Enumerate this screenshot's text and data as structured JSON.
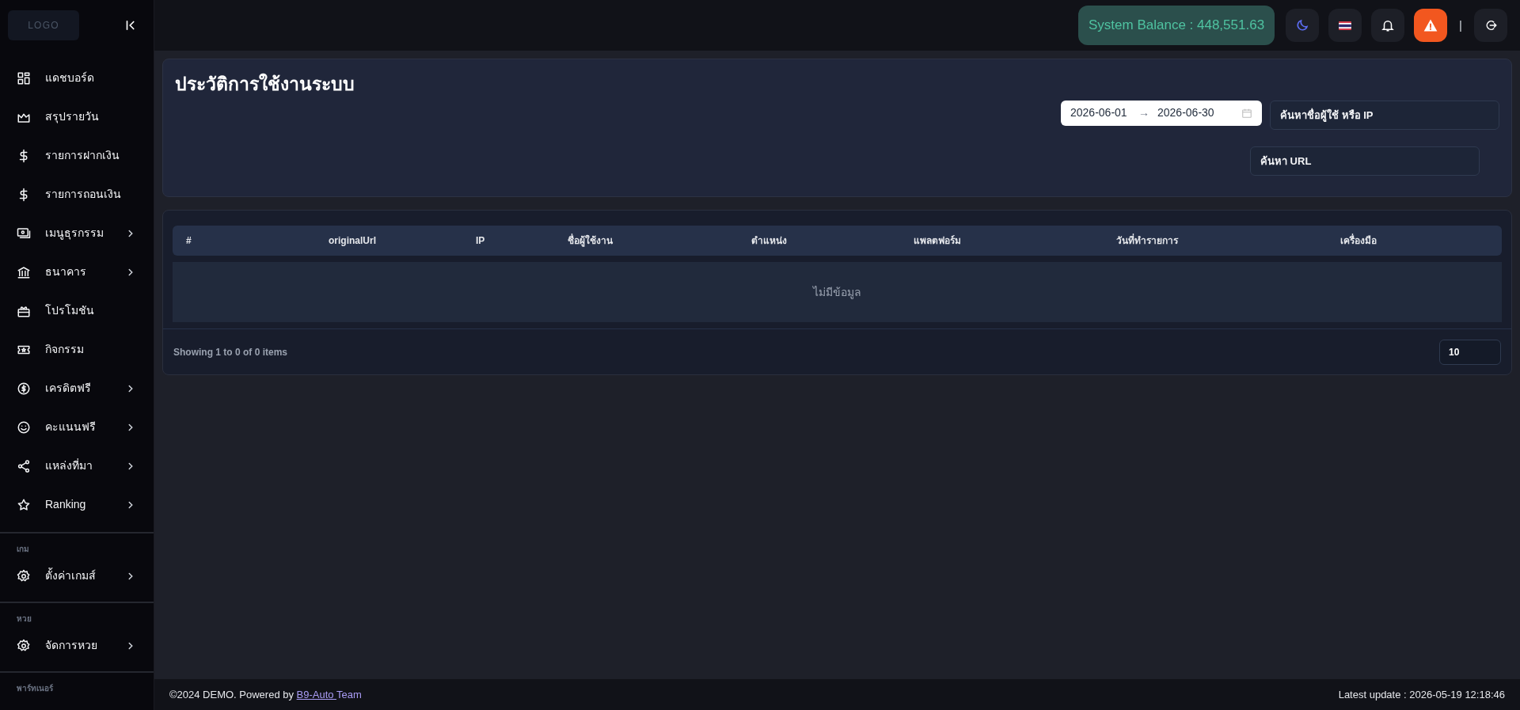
{
  "sidebar": {
    "logo": "LOGO",
    "items": [
      {
        "label": "แดชบอร์ด",
        "has_submenu": false
      },
      {
        "label": "สรุปรายวัน",
        "has_submenu": false
      },
      {
        "label": "รายการฝากเงิน",
        "has_submenu": false
      },
      {
        "label": "รายการถอนเงิน",
        "has_submenu": false
      },
      {
        "label": "เมนูธุรกรรม",
        "has_submenu": true
      },
      {
        "label": "ธนาคาร",
        "has_submenu": true
      },
      {
        "label": "โปรโมชัน",
        "has_submenu": false
      },
      {
        "label": "กิจกรรม",
        "has_submenu": false
      },
      {
        "label": "เครดิตฟรี",
        "has_submenu": true
      },
      {
        "label": "คะแนนฟรี",
        "has_submenu": true
      },
      {
        "label": "แหล่งที่มา",
        "has_submenu": true
      },
      {
        "label": "Ranking",
        "has_submenu": true
      }
    ],
    "sections": [
      {
        "label": "เกม",
        "items": [
          {
            "label": "ตั้งค่าเกมส์",
            "has_submenu": true
          }
        ]
      },
      {
        "label": "หวย",
        "items": [
          {
            "label": "จัดการหวย",
            "has_submenu": true
          }
        ]
      },
      {
        "label": "พาร์ทเนอร์"
      }
    ]
  },
  "topbar": {
    "balance": "System Balance : 448,551.63",
    "separator": "|"
  },
  "page": {
    "title": "ประวัติการใช้งานระบบ",
    "date_from": "2026-06-01",
    "date_to": "2026-06-30",
    "date_arrow": "→",
    "search_user": {
      "placeholder": "ค้นหาชื่อผู้ใช้ หรือ IP"
    },
    "search_url": {
      "placeholder": "ค้นหา URL"
    }
  },
  "table": {
    "columns": [
      "#",
      "originalUrl",
      "IP",
      "ชื่อผู้ใช้งาน",
      "ตำแหน่ง",
      "แพลตฟอร์ม",
      "วันที่ทำรายการ",
      "เครื่องมือ"
    ],
    "empty": "ไม่มีข้อมูล",
    "summary": "Showing 1 to 0 of 0 items",
    "page_size": "10"
  },
  "footer": {
    "copyright": "©2024 DEMO. Powered by ",
    "link": "B9-Auto ",
    "after": "Team",
    "updated": "Latest update : 2026-05-19 12:18:46"
  }
}
